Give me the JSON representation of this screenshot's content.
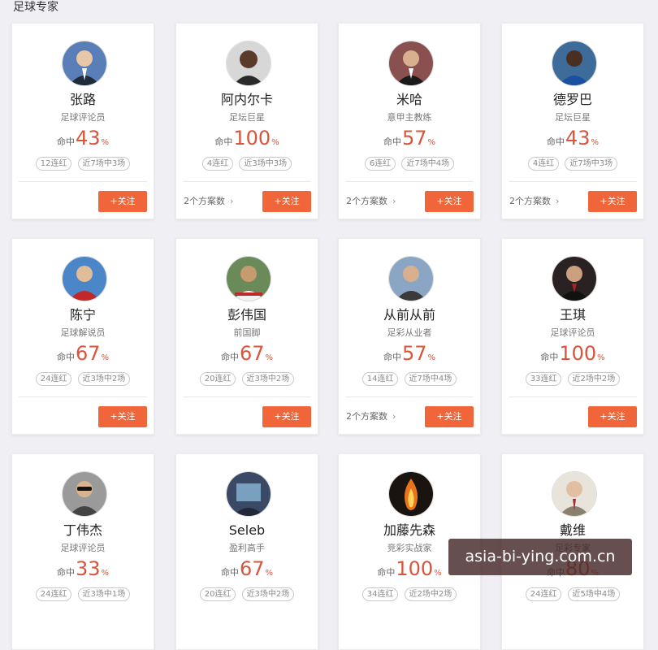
{
  "page": {
    "title": "足球专家"
  },
  "follow_label": "+关注",
  "plans_arrow": "›",
  "colors": {
    "accent": "#f0653a",
    "rate": "#d9543b"
  },
  "experts": [
    {
      "name": "张路",
      "role": "足球评论员",
      "hit_label": "命中",
      "rate": "43",
      "unit": "%",
      "tags": [
        "12连红",
        "近7场中3场"
      ],
      "plans": ""
    },
    {
      "name": "阿内尔卡",
      "role": "足坛巨星",
      "hit_label": "命中",
      "rate": "100",
      "unit": "%",
      "tags": [
        "4连红",
        "近3场中3场"
      ],
      "plans": "2个方案数"
    },
    {
      "name": "米哈",
      "role": "意甲主教练",
      "hit_label": "命中",
      "rate": "57",
      "unit": "%",
      "tags": [
        "6连红",
        "近7场中4场"
      ],
      "plans": "2个方案数"
    },
    {
      "name": "德罗巴",
      "role": "足坛巨星",
      "hit_label": "命中",
      "rate": "43",
      "unit": "%",
      "tags": [
        "4连红",
        "近7场中3场"
      ],
      "plans": "2个方案数"
    },
    {
      "name": "陈宁",
      "role": "足球解说员",
      "hit_label": "命中",
      "rate": "67",
      "unit": "%",
      "tags": [
        "24连红",
        "近3场中2场"
      ],
      "plans": ""
    },
    {
      "name": "彭伟国",
      "role": "前国脚",
      "hit_label": "命中",
      "rate": "67",
      "unit": "%",
      "tags": [
        "20连红",
        "近3场中2场"
      ],
      "plans": ""
    },
    {
      "name": "从前从前",
      "role": "足彩从业者",
      "hit_label": "命中",
      "rate": "57",
      "unit": "%",
      "tags": [
        "14连红",
        "近7场中4场"
      ],
      "plans": "2个方案数"
    },
    {
      "name": "王琪",
      "role": "足球评论员",
      "hit_label": "命中",
      "rate": "100",
      "unit": "%",
      "tags": [
        "33连红",
        "近2场中2场"
      ],
      "plans": ""
    },
    {
      "name": "丁伟杰",
      "role": "足球评论员",
      "hit_label": "命中",
      "rate": "33",
      "unit": "%",
      "tags": [
        "24连红",
        "近3场中1场"
      ],
      "plans": ""
    },
    {
      "name": "Seleb",
      "role": "盈利高手",
      "hit_label": "命中",
      "rate": "67",
      "unit": "%",
      "tags": [
        "20连红",
        "近3场中2场"
      ],
      "plans": ""
    },
    {
      "name": "加藤先森",
      "role": "竞彩实战家",
      "hit_label": "命中",
      "rate": "100",
      "unit": "%",
      "tags": [
        "34连红",
        "近2场中2场"
      ],
      "plans": ""
    },
    {
      "name": "戴维",
      "role": "足彩专家",
      "hit_label": "命中",
      "rate": "80",
      "unit": "%",
      "tags": [
        "24连红",
        "近5场中4场"
      ],
      "plans": ""
    }
  ],
  "watermark": "asia-bi-ying.com.cn"
}
